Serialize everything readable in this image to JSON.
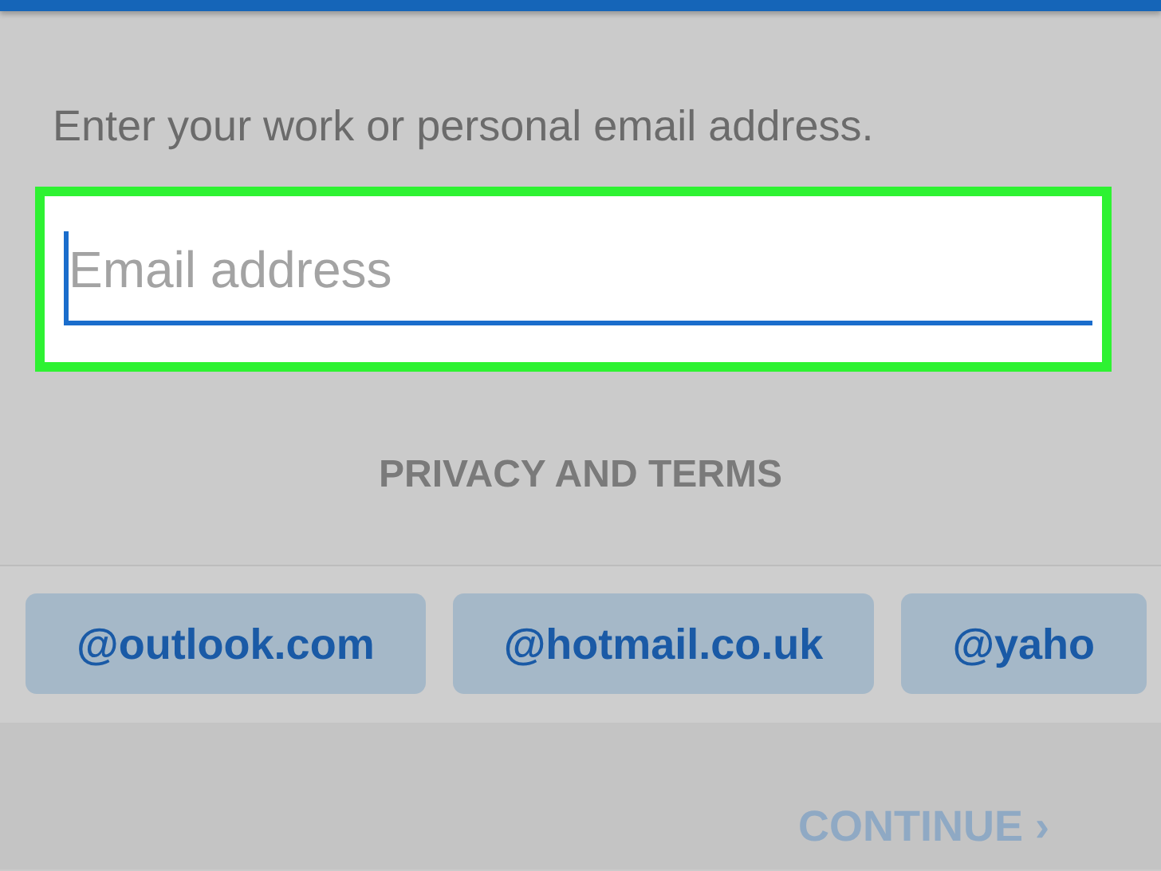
{
  "instruction": "Enter your work or personal email address.",
  "email_field": {
    "placeholder": "Email address",
    "focused": true
  },
  "privacy_link": "PRIVACY AND TERMS",
  "domain_suggestions": [
    "@outlook.com",
    "@hotmail.co.uk",
    "@yaho"
  ],
  "continue_button": {
    "label": "CONTINUE",
    "chevron": "›",
    "disabled": true
  }
}
